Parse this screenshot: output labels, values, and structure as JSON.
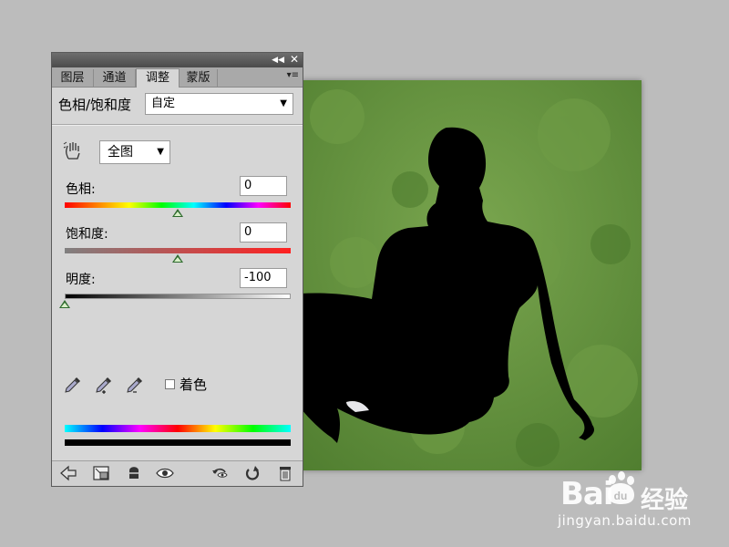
{
  "panel": {
    "tabs": [
      {
        "label": "图层"
      },
      {
        "label": "通道"
      },
      {
        "label": "调整"
      },
      {
        "label": "蒙版"
      }
    ],
    "active_tab": 2,
    "adjustment_name": "色相/饱和度",
    "preset": {
      "value": "自定"
    },
    "range": {
      "value": "全图"
    },
    "sliders": {
      "hue": {
        "label": "色相:",
        "value": "0",
        "level": 0.5
      },
      "saturation": {
        "label": "饱和度:",
        "value": "0",
        "level": 0.5
      },
      "lightness": {
        "label": "明度:",
        "value": "-100",
        "level": 0.0
      }
    },
    "colorize": {
      "label": "着色",
      "checked": false
    }
  },
  "watermark": {
    "logo_text": "Bai",
    "logo_paw_text": "du",
    "cn_text": "经验",
    "url": "jingyan.baidu.com"
  },
  "colors": {
    "panel_bg": "#d6d6d6",
    "titlebar": "#4b4b4b",
    "grass": "#5e8f3a",
    "thumb": "#2e6b2e"
  }
}
